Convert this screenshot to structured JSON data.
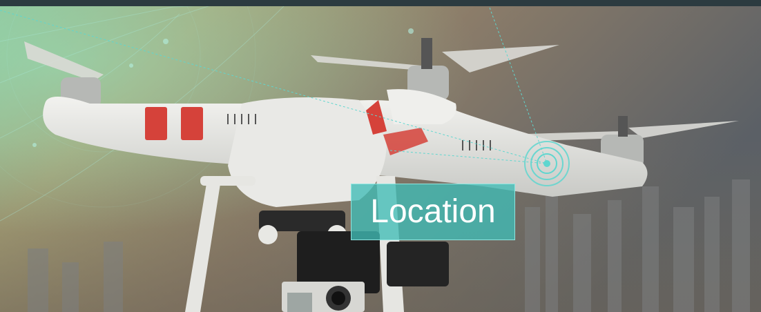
{
  "overlay": {
    "label": "Location"
  },
  "colors": {
    "accent": "#5fd6cf",
    "label_background": "#40bcb6",
    "top_bar": "#2c3b40"
  },
  "icons": [
    "location-pulse-icon"
  ]
}
